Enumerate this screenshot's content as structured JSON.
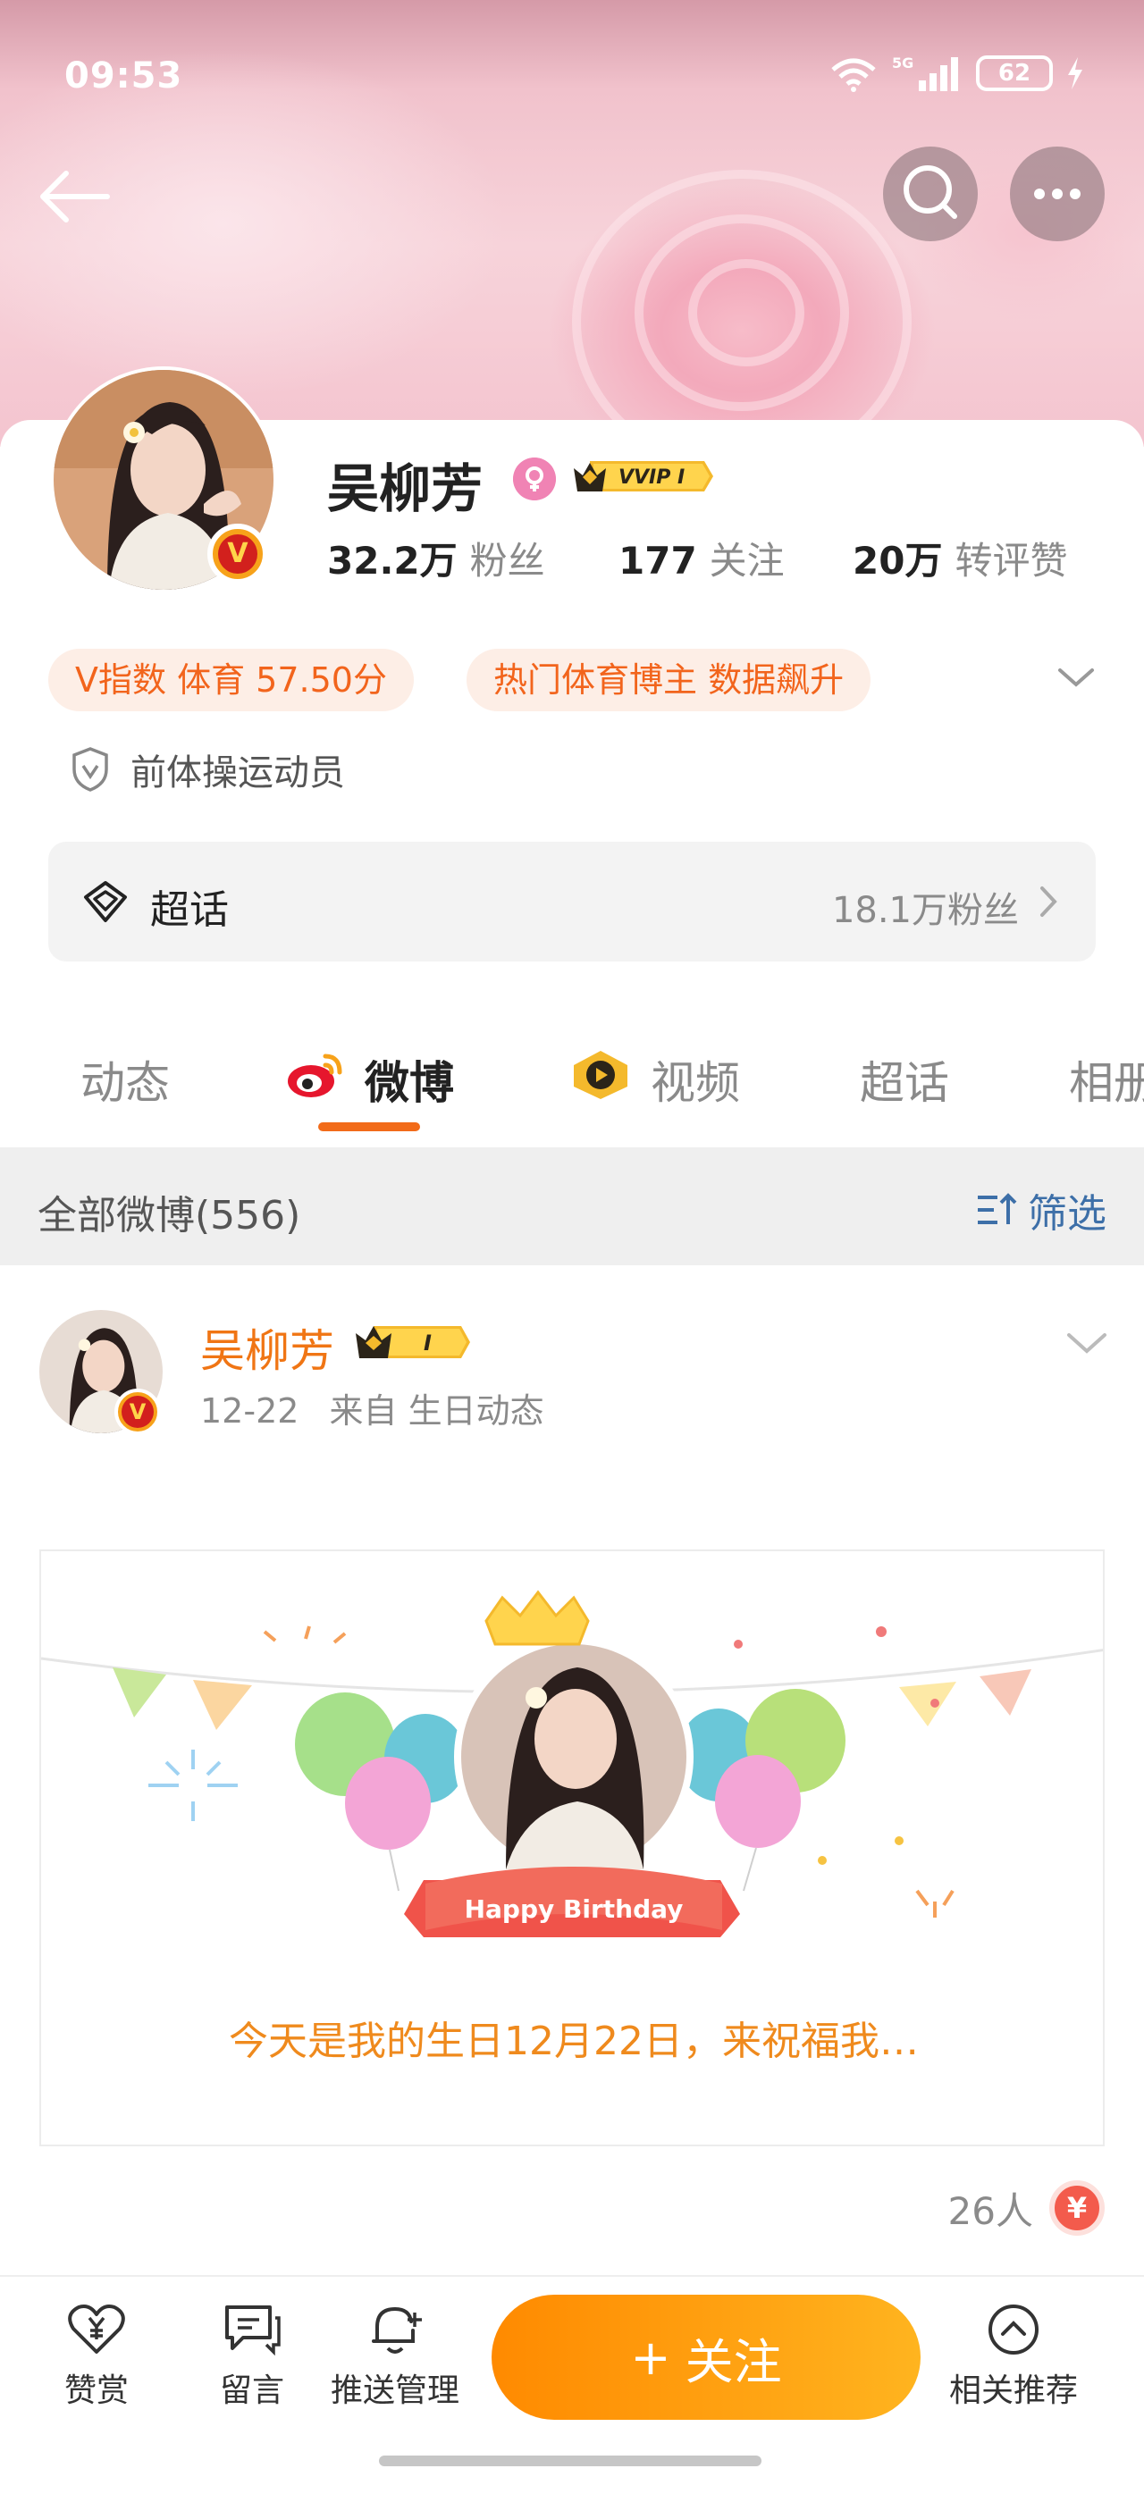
{
  "status_bar": {
    "time": "09:53",
    "network": "5G",
    "battery": "62"
  },
  "profile": {
    "name": "吴柳芳",
    "vip_label": "VVIP I",
    "stats": [
      {
        "value": "32.2万",
        "label": "粉丝"
      },
      {
        "value": "177",
        "label": "关注"
      },
      {
        "value": "20万",
        "label": "转评赞"
      }
    ],
    "tags": [
      "V指数 体育 57.50分",
      "热门体育博主 数据飙升"
    ],
    "identity": "前体操运动员",
    "topic": {
      "label": "超话",
      "count": "18.1万粉丝"
    }
  },
  "tabs": [
    {
      "label": "动态",
      "active": false
    },
    {
      "label": "微博",
      "active": true
    },
    {
      "label": "视频",
      "active": false
    },
    {
      "label": "超话",
      "active": false
    },
    {
      "label": "相册",
      "active": false
    }
  ],
  "filter": {
    "title": "全部微博(556)",
    "button": "筛选"
  },
  "post": {
    "author": "吴柳芳",
    "badge_label": "I",
    "date": "12-22",
    "source": "来自 生日动态",
    "banner_text": "Happy Birthday",
    "message": "今天是我的生日12月22日，来祝福我…",
    "likes": "26人",
    "yen_symbol": "¥"
  },
  "bottom_bar": {
    "reward": "赞赏",
    "message": "留言",
    "push": "推送管理",
    "follow": "关注",
    "follow_plus": "+",
    "recommend": "相关推荐"
  },
  "colors": {
    "accent_orange": "#f26b19",
    "tag_text": "#f2641c",
    "link_blue": "#3d6fa8",
    "follow_gradient_start": "#ff8a00",
    "follow_gradient_end": "#ffb41f"
  }
}
